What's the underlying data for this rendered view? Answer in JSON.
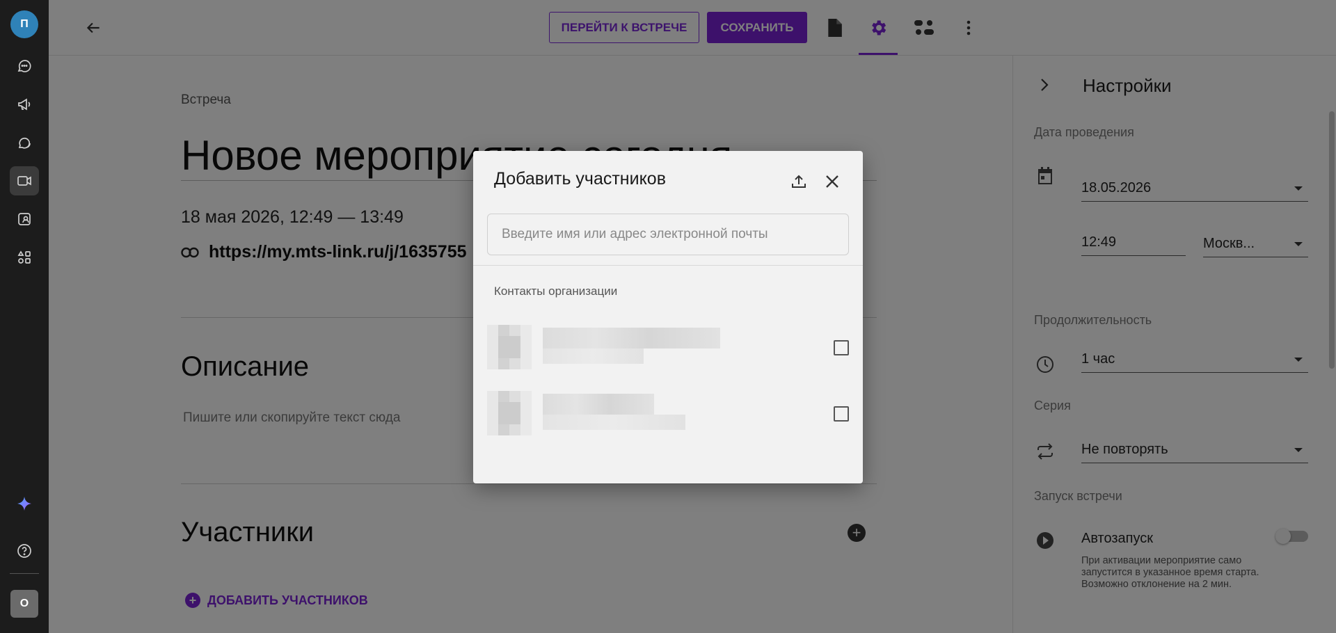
{
  "rail": {
    "avatar_letter": "П",
    "org_letter": "О",
    "items": [
      "chat-icon",
      "megaphone-icon",
      "threads-icon",
      "video-icon",
      "contact-card-icon",
      "apps-icon",
      "ai-sparkle-icon",
      "help-icon"
    ]
  },
  "topbar": {
    "go_to_meeting": "ПЕРЕЙТИ К ВСТРЕЧЕ",
    "save": "СОХРАНИТЬ"
  },
  "event": {
    "breadcrumb": "Встреча",
    "title": "Новое мероприятие сегодня",
    "datetime": "18 мая 2026, 12:49 — 13:49",
    "link": "https://my.mts-link.ru/j/1635755"
  },
  "description": {
    "heading": "Описание",
    "placeholder": "Пишите или скопируйте текст сюда"
  },
  "participants": {
    "heading": "Участники",
    "add_label": "ДОБАВИТЬ УЧАСТНИКОВ"
  },
  "settings": {
    "title": "Настройки",
    "date_label": "Дата проведения",
    "date_value": "18.05.2026",
    "time_value": "12:49",
    "timezone_value": "Москв...",
    "duration_label": "Продолжительность",
    "duration_value": "1 час",
    "series_label": "Серия",
    "series_value": "Не повторять",
    "launch_label": "Запуск встречи",
    "autostart_label": "Автозапуск",
    "autostart_help": "При активации мероприятие само запустится в указанное время старта. Возможно отклонение на 2 мин.",
    "autostart_on": false
  },
  "modal": {
    "title": "Добавить участников",
    "search_placeholder": "Введите имя или адрес электронной почты",
    "section_label": "Контакты организации",
    "contacts": [
      {
        "checked": false
      },
      {
        "checked": false
      }
    ]
  },
  "colors": {
    "accent": "#7a22d6",
    "rail_bg": "#1c1c1c",
    "overlay": "rgba(0,0,0,0.5)"
  }
}
